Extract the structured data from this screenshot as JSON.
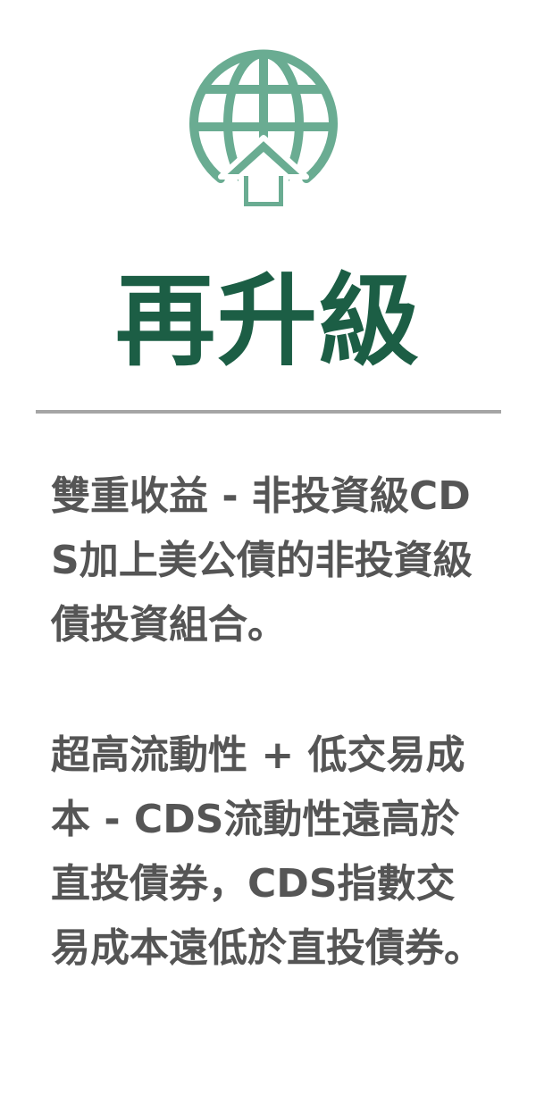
{
  "header": {
    "title": "再升級"
  },
  "icon": {
    "name": "globe-upgrade-icon",
    "color": "#6aac92"
  },
  "colors": {
    "title": "#1c5e45",
    "divider": "#a5a5a5",
    "body_text": "#555555"
  },
  "paragraphs": [
    {
      "text": "雙重收益 - 非投資級CDS加上美公債的非投資級債投資組合。"
    },
    {
      "text": "超高流動性 + 低交易成本 - CDS流動性遠高於直投債券，CDS指數交易成本遠低於直投債券。"
    }
  ]
}
